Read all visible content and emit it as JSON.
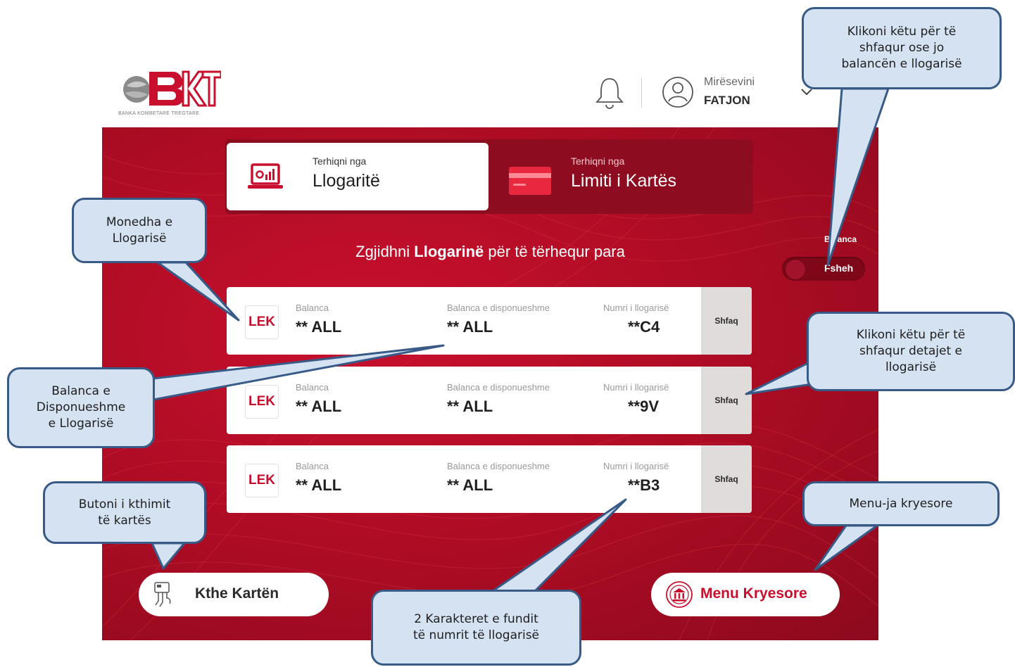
{
  "header": {
    "logo_text": "BKT",
    "logo_tagline": "BANKA KOMBETARE TREGTARE",
    "welcome": "Mirësevini",
    "user": "FATJON"
  },
  "tabs": [
    {
      "small": "Terhiqni nga",
      "big": "Llogaritë",
      "icon": "laptop-chart-icon",
      "active": true
    },
    {
      "small": "Terhiqni nga",
      "big": "Limiti i Kartës",
      "icon": "credit-card-icon",
      "active": false
    }
  ],
  "heading": {
    "pre": "Zgjidhni ",
    "strong": "Llogarinë",
    "post": " për të tërhequr para"
  },
  "balance_toggle": {
    "label": "Balanca",
    "state": "Fsheh"
  },
  "account_labels": {
    "balance": "Balanca",
    "available": "Balanca e disponueshme",
    "number": "Numri i llogarisë",
    "show": "Shfaq"
  },
  "accounts": [
    {
      "currency": "LEK",
      "balance": "** ALL",
      "available": "** ALL",
      "number": "**C4"
    },
    {
      "currency": "LEK",
      "balance": "** ALL",
      "available": "** ALL",
      "number": "**9V"
    },
    {
      "currency": "LEK",
      "balance": "** ALL",
      "available": "** ALL",
      "number": "**B3"
    }
  ],
  "buttons": {
    "return_card": "Kthe Kartën",
    "main_menu": "Menu Kryesore"
  },
  "callouts": {
    "balance_toggle": "Klikoni këtu për të\nshfaqur ose jo\nbalancën e llogarisë",
    "currency": "Monedha e\nLlogarisë",
    "details": "Klikoni këtu për të\nshfaqur detajet e\nllogarisë",
    "available": "Balanca e\nDisponueshme\ne Llogarisë",
    "return_card": "Butoni i kthimit\ntë kartës",
    "main_menu": "Menu-ja kryesore",
    "last_chars": "2 Karakteret e fundit\ntë numrit të llogarisë"
  },
  "colors": {
    "brand_red": "#c8102e",
    "dark_red": "#8e0c1f",
    "callout_fill": "#d4e2f2",
    "callout_border": "#385a86"
  }
}
